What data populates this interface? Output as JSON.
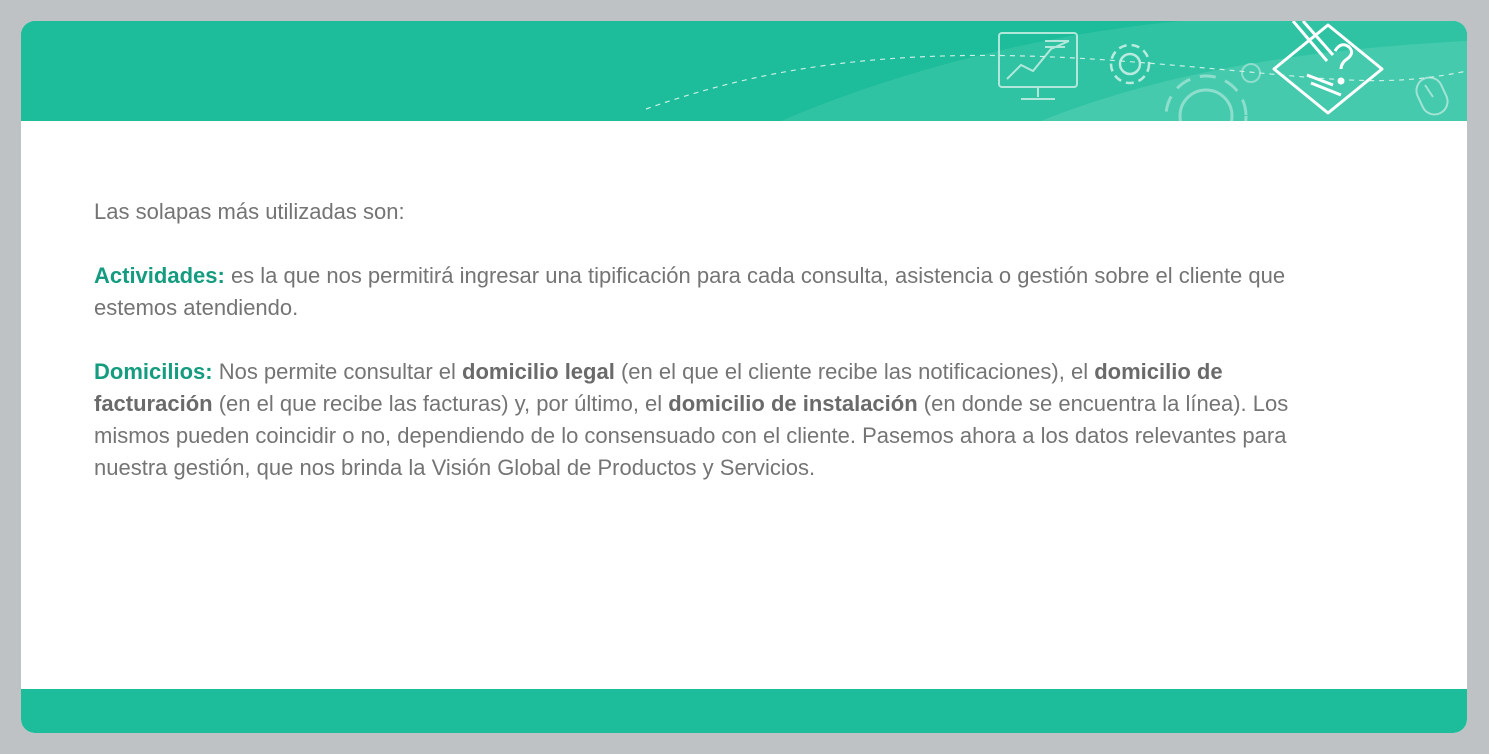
{
  "intro": "Las solapas más utilizadas son:",
  "actividades": {
    "term": "Actividades:",
    "text": " es la que nos permitirá ingresar una tipificación para cada consulta, asistencia o gestión sobre el cliente que estemos atendiendo."
  },
  "domicilios": {
    "term": "Domicilios:",
    "t1": " Nos permite consultar el ",
    "b1": "domicilio legal",
    "t2": " (en el que el cliente recibe las notificaciones), el ",
    "b2": "domicilio de facturación",
    "t3": " (en el que recibe las facturas) y, por último, el ",
    "b3": "domicilio de instalación",
    "t4": " (en donde se encuentra la línea). Los mismos pueden coincidir o no, dependiendo de lo consensuado con el cliente. Pasemos ahora a los datos relevantes para nuestra gestión, que nos brinda la Visión Global de Productos y Servicios."
  },
  "colors": {
    "accent": "#1dbc9a",
    "term": "#159c80",
    "text": "#747474",
    "frame": "#bfc2c5"
  },
  "icons": [
    "monitor-chart-icon",
    "gear-icon",
    "gear-large-icon",
    "pencil-question-icon",
    "mouse-icon"
  ]
}
